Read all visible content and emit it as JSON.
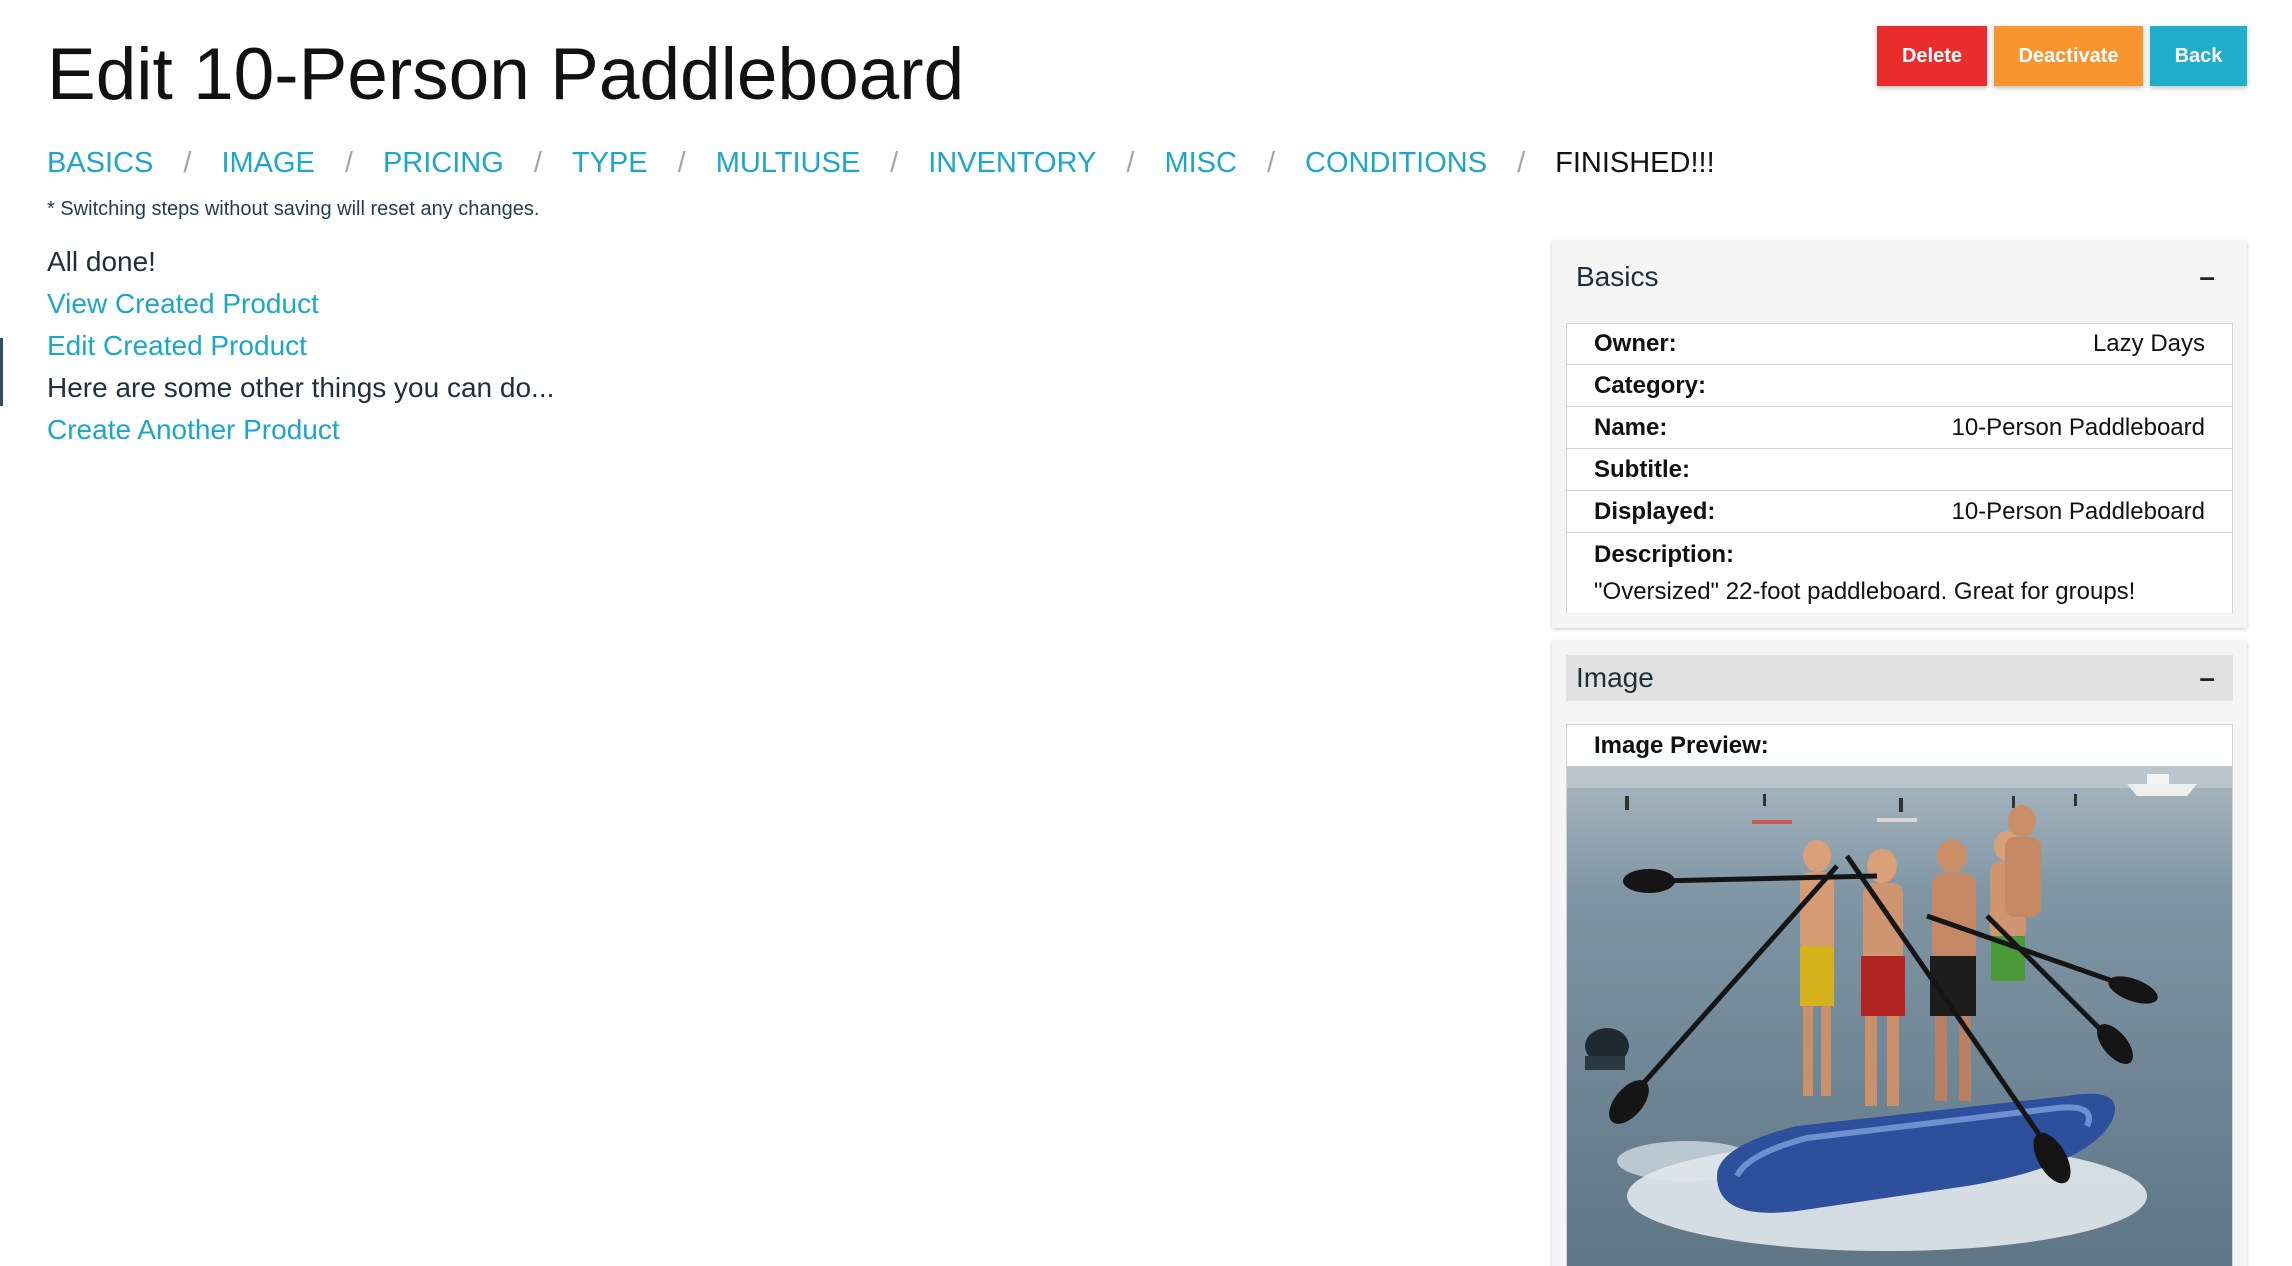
{
  "page": {
    "title": "Edit 10-Person Paddleboard"
  },
  "actions": {
    "delete": "Delete",
    "deactivate": "Deactivate",
    "back": "Back"
  },
  "steps": [
    "BASICS",
    "IMAGE",
    "PRICING",
    "TYPE",
    "MULTIUSE",
    "INVENTORY",
    "MISC",
    "CONDITIONS",
    "FINISHED!!!"
  ],
  "step_separator": "/",
  "note": "* Switching steps without saving will reset any changes.",
  "finished": {
    "all_done": "All done!",
    "view_link": "View Created Product",
    "edit_link": "Edit Created Product",
    "other_things": "Here are some other things you can do...",
    "create_link": "Create Another Product"
  },
  "basics_panel": {
    "title": "Basics",
    "collapse": "–",
    "owner_label": "Owner:",
    "owner_value": "Lazy Days",
    "category_label": "Category:",
    "category_value": "",
    "name_label": "Name:",
    "name_value": "10-Person Paddleboard",
    "subtitle_label": "Subtitle:",
    "subtitle_value": "",
    "displayed_label": "Displayed:",
    "displayed_value": "10-Person Paddleboard",
    "description_label": "Description:",
    "description_value": "\"Oversized\" 22-foot paddleboard. Great for groups!"
  },
  "image_panel": {
    "title": "Image",
    "collapse": "–",
    "preview_label": "Image Preview:"
  },
  "colors": {
    "link": "#1ca6c9",
    "delete": "#ea2c2c",
    "deactivate": "#f9952e",
    "back": "#1eaecb"
  }
}
